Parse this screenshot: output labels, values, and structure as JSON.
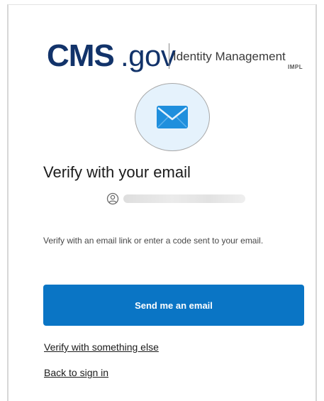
{
  "logo": {
    "brand_bold": "CMS",
    "brand_domain": ".gov",
    "product": "Identity Management",
    "environment": "IMPL"
  },
  "badge": {
    "icon": "envelope-icon"
  },
  "main": {
    "title": "Verify with your email",
    "identity": {
      "icon": "user-icon",
      "masked_value": "••••••••••••••••••••••"
    },
    "instructions": "Verify with an email link or enter a code sent to your email.",
    "send_button_label": "Send me an email",
    "verify_other_label": "Verify with something else",
    "back_label": "Back to sign in"
  },
  "colors": {
    "brand_navy": "#12336a",
    "primary_button": "#0a75c5",
    "badge_background": "#e5f2fc"
  }
}
